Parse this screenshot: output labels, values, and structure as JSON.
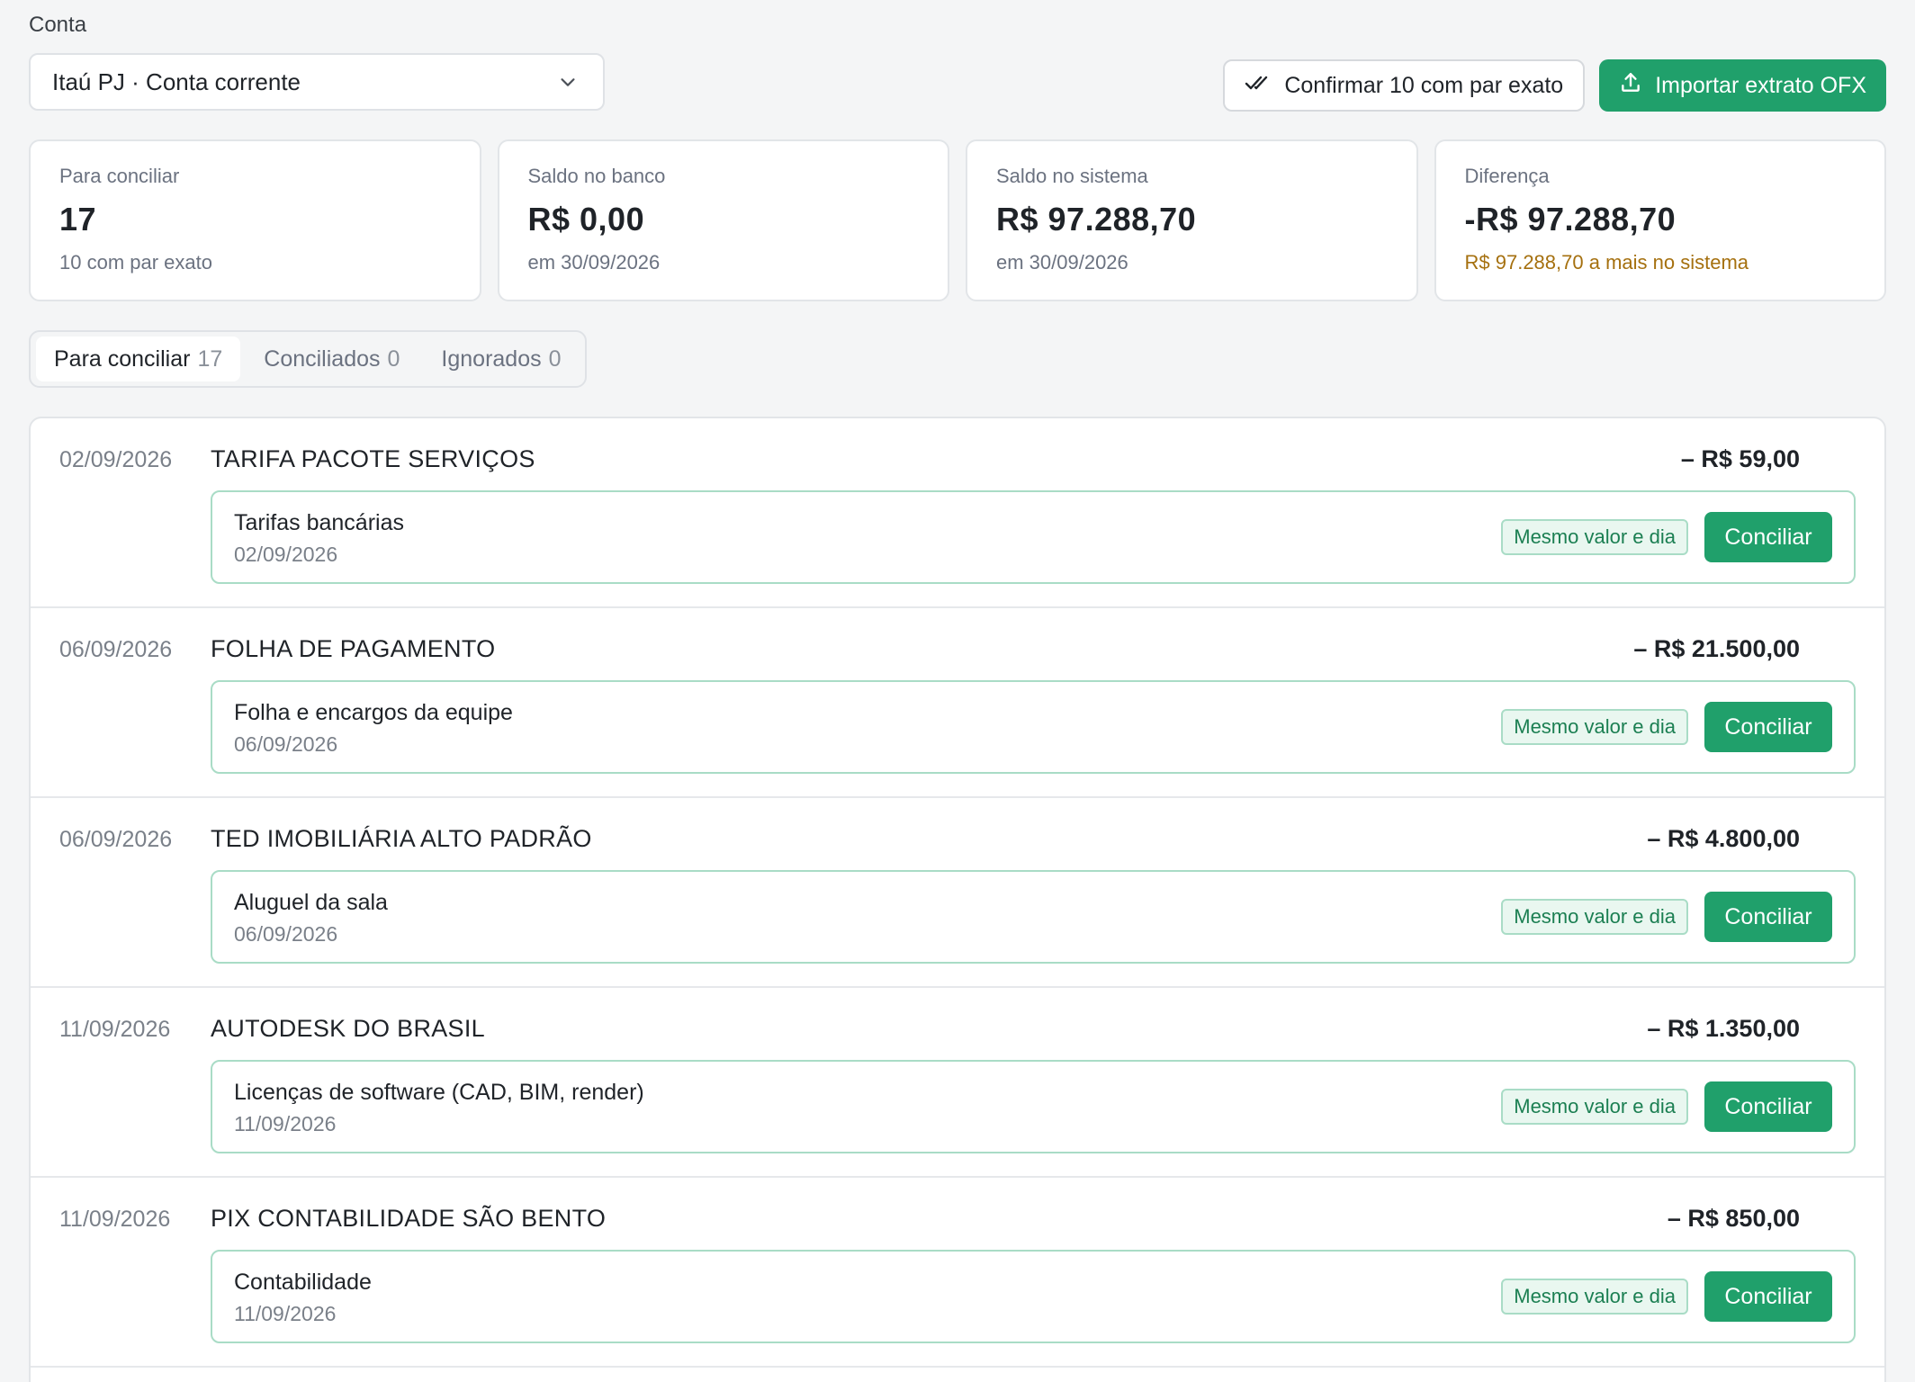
{
  "conta": {
    "label": "Conta",
    "selected": "Itaú PJ · Conta corrente"
  },
  "actions": {
    "confirm_label": "Confirmar 10 com par exato",
    "import_label": "Importar extrato OFX"
  },
  "cards": [
    {
      "label": "Para conciliar",
      "value": "17",
      "sub": "10 com par exato"
    },
    {
      "label": "Saldo no banco",
      "value": "R$ 0,00",
      "sub": "em 30/09/2026"
    },
    {
      "label": "Saldo no sistema",
      "value": "R$ 97.288,70",
      "sub": "em 30/09/2026"
    },
    {
      "label": "Diferença",
      "value": "-R$ 97.288,70",
      "sub": "R$ 97.288,70 a mais no sistema"
    }
  ],
  "tabs": [
    {
      "label": "Para conciliar",
      "count": "17"
    },
    {
      "label": "Conciliados",
      "count": "0"
    },
    {
      "label": "Ignorados",
      "count": "0"
    }
  ],
  "transactions": [
    {
      "date": "02/09/2026",
      "description": "TARIFA PACOTE SERVIÇOS",
      "amount": "– R$ 59,00",
      "match_title": "Tarifas bancárias",
      "match_date": "02/09/2026",
      "badge": "Mesmo valor e dia",
      "action": "Conciliar"
    },
    {
      "date": "06/09/2026",
      "description": "FOLHA DE PAGAMENTO",
      "amount": "– R$ 21.500,00",
      "match_title": "Folha e encargos da equipe",
      "match_date": "06/09/2026",
      "badge": "Mesmo valor e dia",
      "action": "Conciliar"
    },
    {
      "date": "06/09/2026",
      "description": "TED IMOBILIÁRIA ALTO PADRÃO",
      "amount": "– R$ 4.800,00",
      "match_title": "Aluguel da sala",
      "match_date": "06/09/2026",
      "badge": "Mesmo valor e dia",
      "action": "Conciliar"
    },
    {
      "date": "11/09/2026",
      "description": "AUTODESK DO BRASIL",
      "amount": "– R$ 1.350,00",
      "match_title": "Licenças de software (CAD, BIM, render)",
      "match_date": "11/09/2026",
      "badge": "Mesmo valor e dia",
      "action": "Conciliar"
    },
    {
      "date": "11/09/2026",
      "description": "PIX CONTABILIDADE SÃO BENTO",
      "amount": "– R$ 850,00",
      "match_title": "Contabilidade",
      "match_date": "11/09/2026",
      "badge": "Mesmo valor e dia",
      "action": "Conciliar"
    }
  ],
  "icons": {
    "select": "chevron-down-icon",
    "confirm": "double-check-icon",
    "import": "upload-icon"
  },
  "colors": {
    "accent": "#20a06b",
    "warning": "#a5700f"
  }
}
